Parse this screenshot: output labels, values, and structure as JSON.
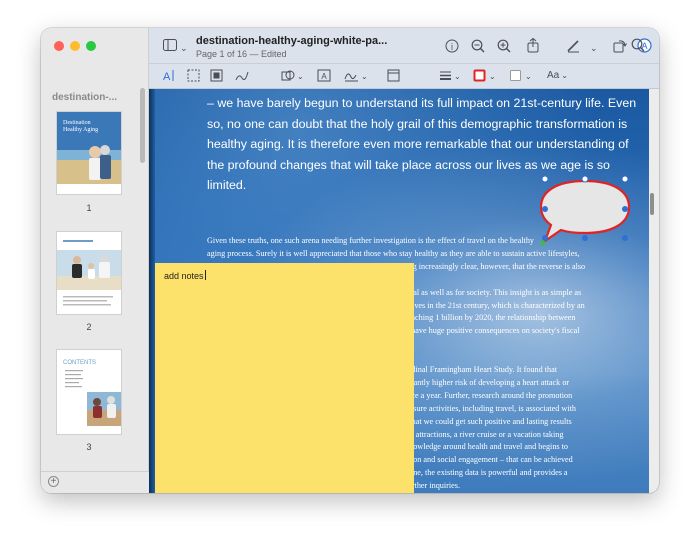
{
  "window": {
    "title": "destination-healthy-aging-white-pa...",
    "subtitle": "Page 1 of 16 — Edited"
  },
  "sidebar": {
    "title": "destination-...",
    "thumbnails": [
      {
        "page": "1",
        "cover_text": "Destination Healthy Aging"
      },
      {
        "page": "2"
      },
      {
        "page": "3",
        "cover_text": "CONTENTS"
      }
    ]
  },
  "toolbar": {
    "icons": [
      "sidebar-icon",
      "chevron-down-icon",
      "info-icon",
      "zoom-out-icon",
      "zoom-in-icon",
      "share-icon",
      "markup-pen-icon",
      "chevron-down-icon",
      "rotate-icon",
      "markup-icon",
      "search-icon"
    ]
  },
  "markup": {
    "tools": [
      "text-selection-icon",
      "rectangular-selection-icon",
      "sketch-icon",
      "draw-icon",
      "shapes-icon",
      "text-box-icon",
      "sign-icon",
      "note-icon",
      "shape-style-icon",
      "border-color-icon",
      "fill-color-icon",
      "text-style-icon"
    ],
    "text_style_label": "Aa",
    "border_color": "#e02424",
    "fill_color": "#ffffff"
  },
  "document": {
    "paragraph1": "– we have barely begun to understand its full impact on 21st-century life.  Even so, no one can doubt that the holy grail of this demographic transformation is healthy aging.  It is therefore even more remarkable that our understanding of the profound changes that will take place across our lives as we age is so limited.",
    "paragraph2_lines": [
      "Given these truths, one such arena needing further investigation is the effect of travel on the healthy",
      "aging process. Surely it is well appreciated that those who stay healthy as they are able to sustain active lifestyles,",
      "including traveling into our 70s, 80s and beyond.  It is becoming increasingly clear, however, that the reverse is also true",
      "dual as well as for society.  This insight is as simple as",
      "r lives in the 21st century, which is characterized by an",
      "reaching 1 billion by 2020, the relationship between",
      "y have huge positive consequences on society's fiscal",
      "",
      "",
      "tudinal Framingham Heart Study. It found that",
      "ficantly higher risk of developing a heart attack or",
      "vice a year.  Further, research around the promotion",
      "leisure activities, including travel, is associated with",
      "t that we could get such positive and lasting results",
      "ral attractions, a river cruise or a vacation taking",
      "knowledge around health and travel and begins to",
      "ation and social engagement – that can be achieved",
      "done, the existing data is powerful and provides a",
      "further inquiries."
    ],
    "note_text": "add notes",
    "note_color": "#fce26b",
    "bubble_border_color": "#e02424"
  }
}
